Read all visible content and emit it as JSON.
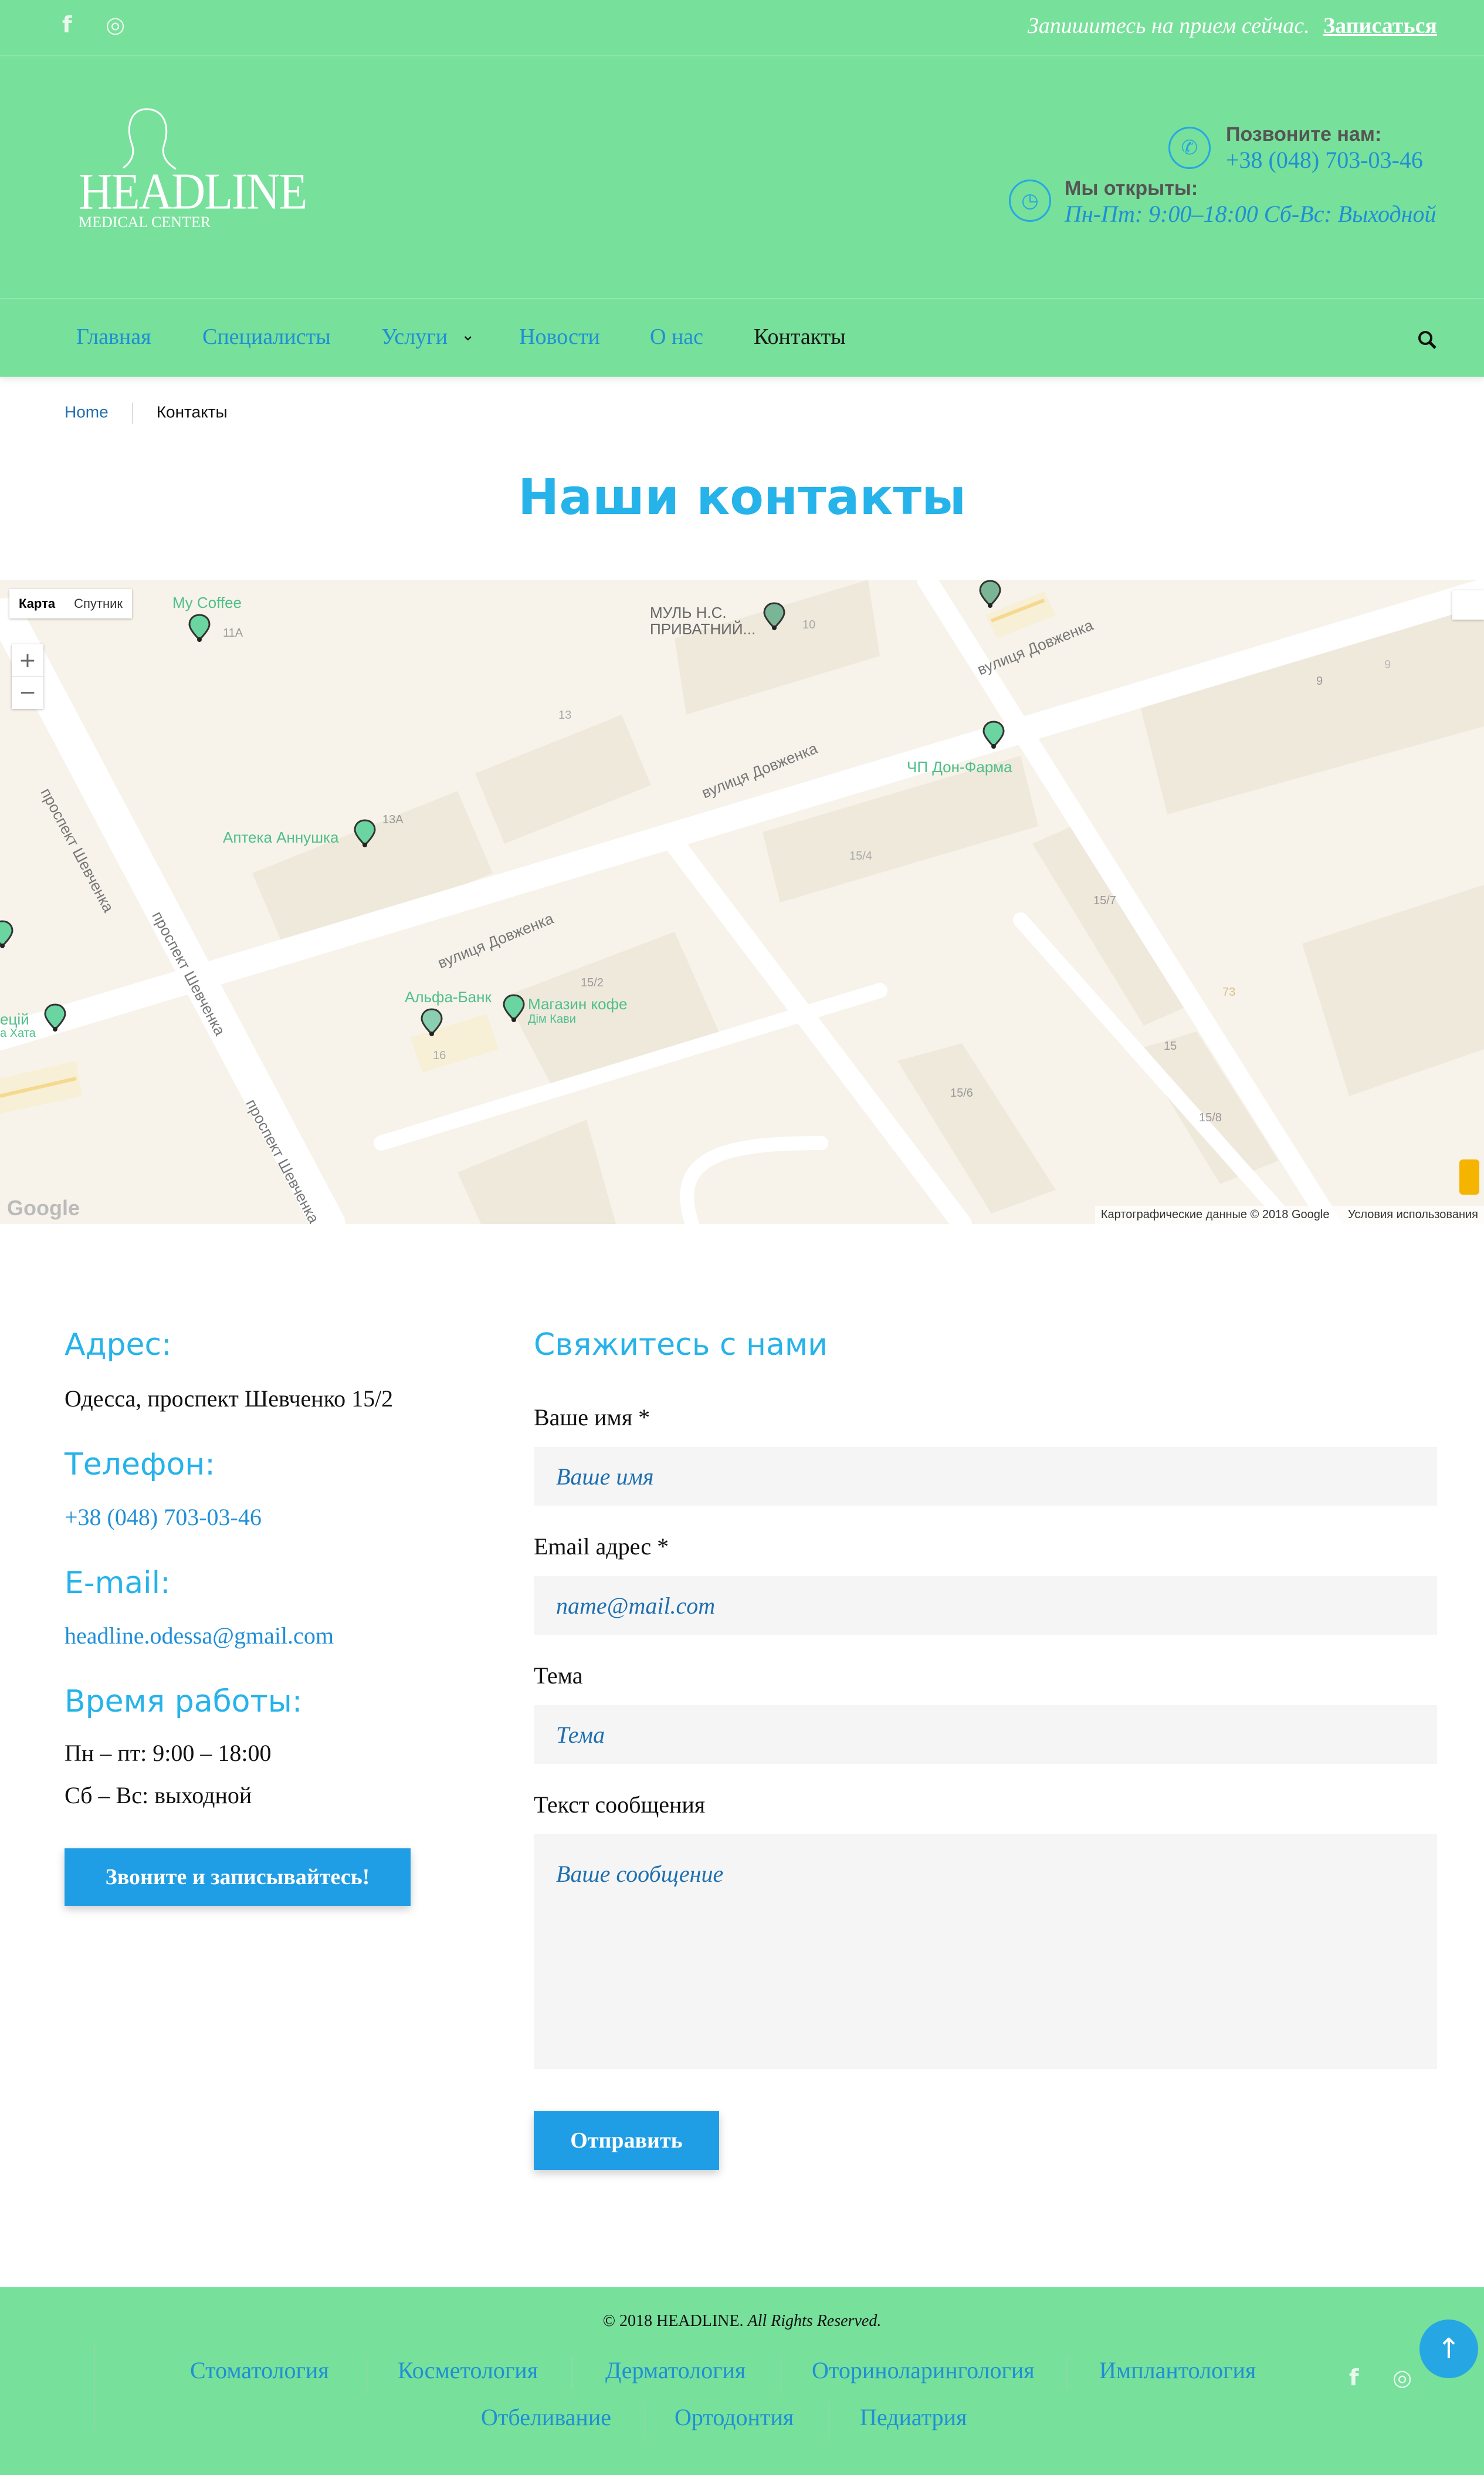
{
  "topbar": {
    "facebook_icon": "f",
    "instagram_icon": "◎",
    "cta_text": "Запишитесь на прием сейчас.",
    "cta_link": "Записаться"
  },
  "header": {
    "logo_text": "HEADLINE",
    "logo_sub": "MEDICAL CENTER",
    "call_label": "Позвоните нам:",
    "call_value": "+38 (048) 703-03-46",
    "open_label": "Мы открыты:",
    "open_value": "Пн-Пт: 9:00–18:00 Сб-Вс: Выходной"
  },
  "nav": {
    "items": [
      "Главная",
      "Специалисты",
      "Услуги",
      "Новости",
      "О нас",
      "Контакты"
    ],
    "active": "Контакты"
  },
  "breadcrumb": {
    "home": "Home",
    "current": "Контакты"
  },
  "page_title": "Наши контакты",
  "map": {
    "type_map": "Карта",
    "type_sat": "Спутник",
    "zoom_in": "+",
    "zoom_out": "−",
    "google": "Google",
    "copyright": "Картографические данные © 2018 Google",
    "terms": "Условия использования",
    "pois": [
      "My Coffee",
      "МУЛЬ Н.С. ПРИВАТНИЙ...",
      "ЧП Дон-Фарма",
      "Аптека Аннушка",
      "Альфа-Банк",
      "Магазин кофе",
      "Дім Кави",
      "ецій",
      "а Хата"
    ],
    "streets": [
      "проспект Шевченка",
      "проспект Шевченка",
      "проспект Шевченка",
      "вулиця Довженка",
      "вулиця Довженка",
      "вулиця Довженка"
    ],
    "numbers": [
      "11А",
      "13",
      "13А",
      "10",
      "9",
      "9",
      "15/4",
      "15/7",
      "15/2",
      "16",
      "15/6",
      "15",
      "15/8",
      "73"
    ]
  },
  "contacts": {
    "address_title": "Адрес:",
    "address": "Одесса, проспект Шевченко 15/2",
    "phone_title": "Телефон:",
    "phone": "+38 (048) 703-03-46",
    "email_title": "E-mail:",
    "email": "headline.odessa@gmail.com",
    "hours_title": "Время работы:",
    "hours_1": "Пн – пт: 9:00 – 18:00",
    "hours_2": "Сб – Вс: выходной",
    "call_button": "Звоните и записывайтесь!"
  },
  "form": {
    "title": "Свяжитесь с нами",
    "name_label": "Ваше имя *",
    "name_placeholder": "Ваше имя",
    "email_label": "Email адрес *",
    "email_placeholder": "name@mail.com",
    "subject_label": "Тема",
    "subject_placeholder": "Тема",
    "message_label": "Текст сообщения",
    "message_placeholder": "Ваше сообщение",
    "submit": "Отправить"
  },
  "footer": {
    "copyright_1": "© 2018 HEADLINE.",
    "copyright_2": "All Rights Reserved.",
    "links_row1": [
      "Стоматология",
      "Косметология",
      "Дерматология",
      "Оториноларингология",
      "Имплантология"
    ],
    "links_row2": [
      "Отбеливание",
      "Ортодонтия",
      "Педиатрия"
    ],
    "to_top": "↑"
  },
  "colors": {
    "brand_green": "#77e09a",
    "accent_blue": "#26b3e9",
    "link_blue": "#1f8fd6",
    "button_blue": "#1f9ee6"
  }
}
